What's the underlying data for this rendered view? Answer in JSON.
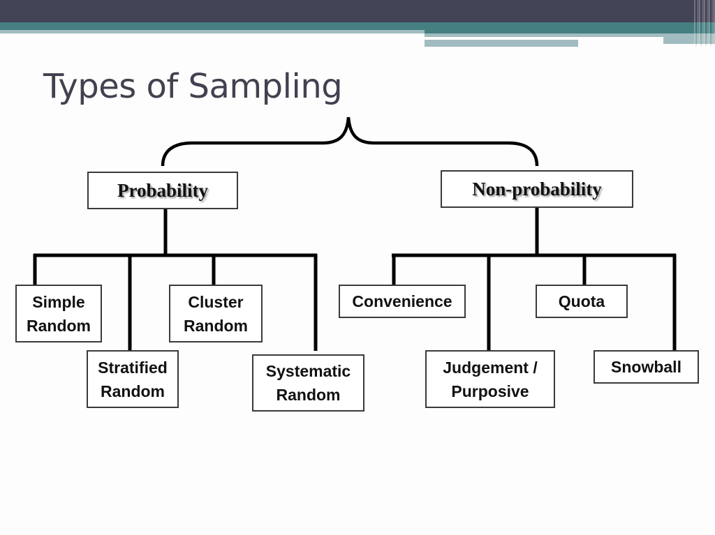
{
  "slide": {
    "title": "Types of Sampling",
    "theme_colors": {
      "header_dark": "#434356",
      "header_teal": "#457f82",
      "header_light": "#a1bcc0"
    }
  },
  "diagram": {
    "root_connector": "brace-icon",
    "categories": [
      {
        "label": "Probability",
        "children": [
          {
            "label": "Simple\nRandom"
          },
          {
            "label": "Stratified\nRandom"
          },
          {
            "label": "Cluster\nRandom"
          },
          {
            "label": "Systematic\nRandom"
          }
        ]
      },
      {
        "label": "Non-probability",
        "children": [
          {
            "label": "Convenience"
          },
          {
            "label": "Judgement /\nPurposive"
          },
          {
            "label": "Quota"
          },
          {
            "label": "Snowball"
          }
        ]
      }
    ]
  }
}
